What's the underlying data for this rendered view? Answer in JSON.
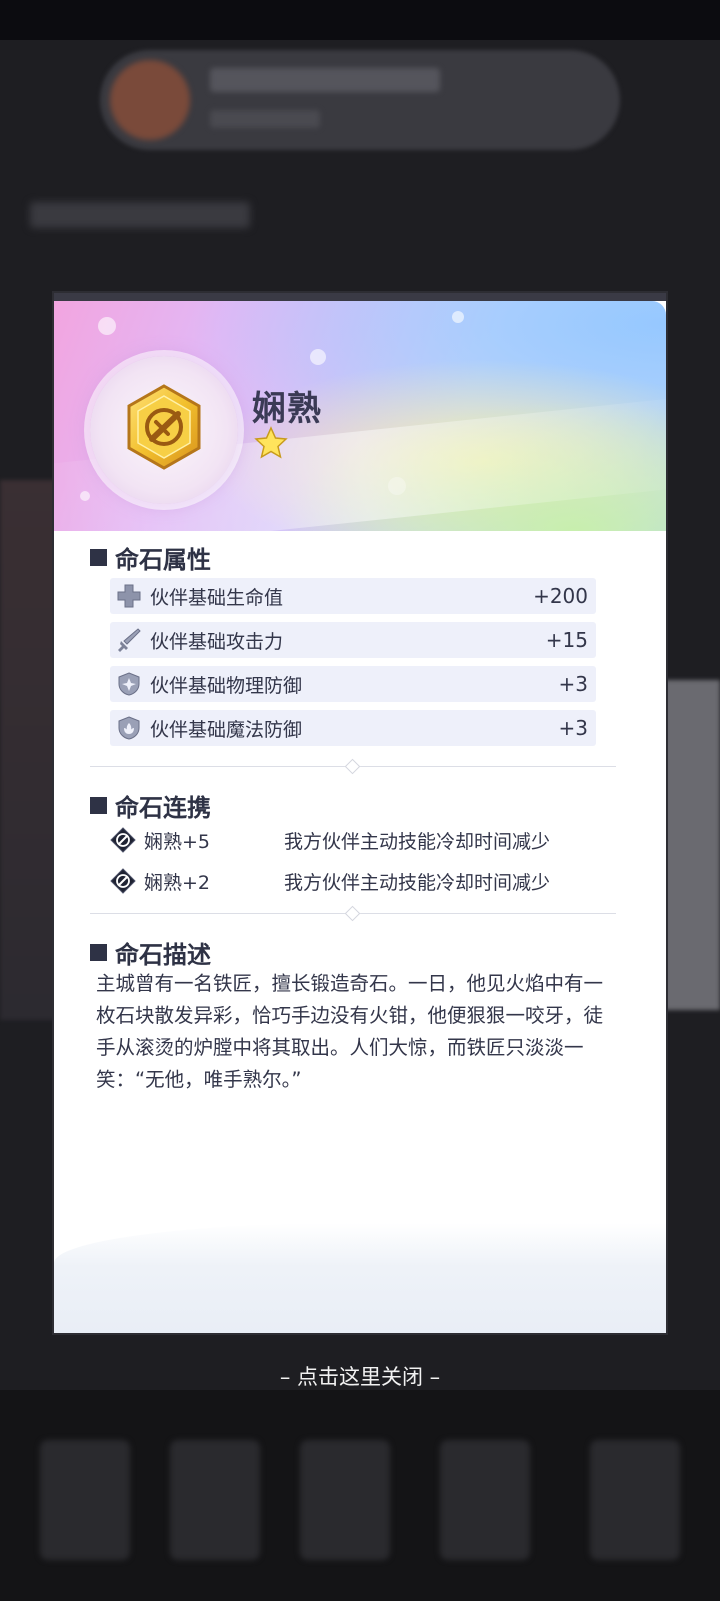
{
  "gem": {
    "name": "娴熟",
    "stars": 1,
    "icon": "sword-gem-icon"
  },
  "sections": {
    "attributes_title": "命石属性",
    "links_title": "命石连携",
    "description_title": "命石描述"
  },
  "attributes": [
    {
      "icon": "hp-cross-icon",
      "label": "伙伴基础生命值",
      "value": "+200"
    },
    {
      "icon": "sword-icon",
      "label": "伙伴基础攻击力",
      "value": "+15"
    },
    {
      "icon": "shield-icon",
      "label": "伙伴基础物理防御",
      "value": "+3"
    },
    {
      "icon": "magic-shield-icon",
      "label": "伙伴基础魔法防御",
      "value": "+3"
    }
  ],
  "links": [
    {
      "icon": "link-gem-icon",
      "name": "娴熟+5",
      "effect": "我方伙伴主动技能冷却时间减少"
    },
    {
      "icon": "link-gem-icon",
      "name": "娴熟+2",
      "effect": "我方伙伴主动技能冷却时间减少"
    }
  ],
  "description": "主城曾有一名铁匠，擅长锻造奇石。一日，他见火焰中有一枚石块散发异彩，恰巧手边没有火钳，他便狠狠一咬牙，徒手从滚烫的炉膛中将其取出。人们大惊，而铁匠只淡淡一笑：“无他，唯手熟尔。”",
  "close_hint": "– 点击这里关闭 –",
  "colors": {
    "text_dark": "#2e3245",
    "row_bg": "#eef0fa",
    "gem_gold": "#f2c02e"
  }
}
